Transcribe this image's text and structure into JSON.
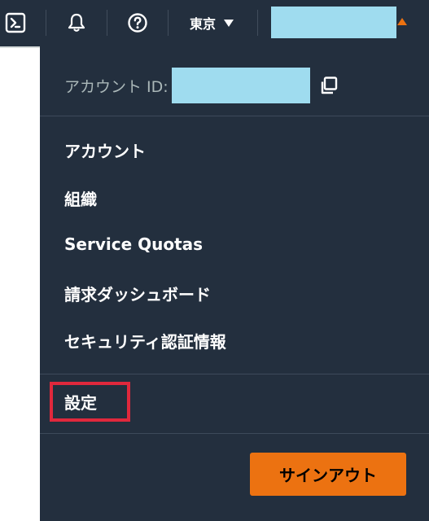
{
  "topbar": {
    "icons": [
      "cloudshell-icon",
      "bell-icon",
      "help-icon"
    ],
    "region_label": "東京",
    "account_indicator_color": "#ec7211"
  },
  "menu": {
    "account_id_label": "アカウント ID:",
    "items": [
      {
        "label": "アカウント"
      },
      {
        "label": "組織"
      },
      {
        "label": "Service Quotas"
      },
      {
        "label": "請求ダッシュボード"
      },
      {
        "label": "セキュリティ認証情報"
      }
    ],
    "settings_label": "設定",
    "signout_label": "サインアウト"
  },
  "colors": {
    "background": "#232f3e",
    "accent": "#ec7211",
    "highlight_box": "#e0283c",
    "redaction": "#9fdcef"
  }
}
